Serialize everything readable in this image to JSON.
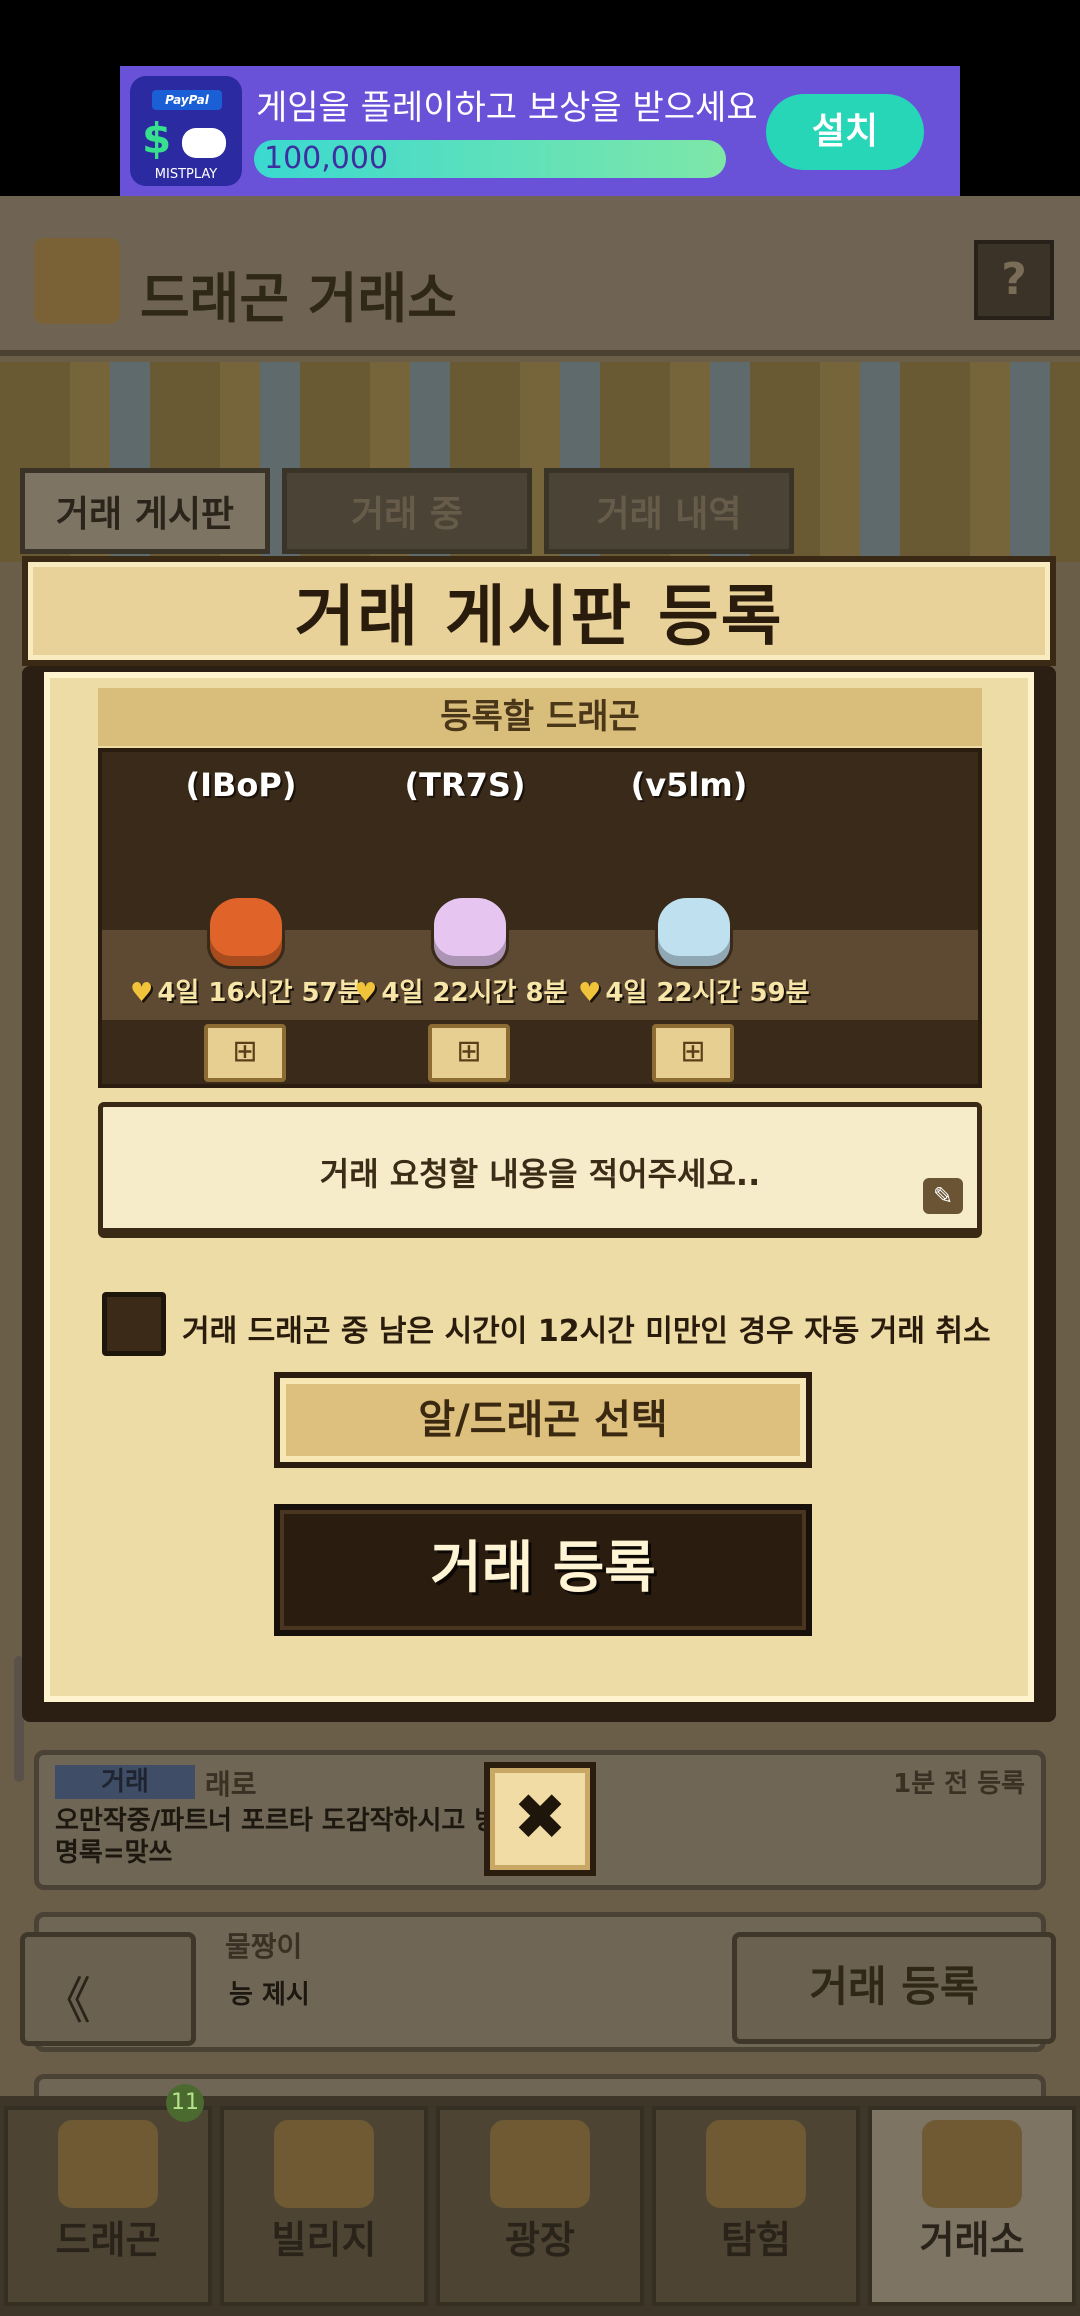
{
  "ad": {
    "logo_paypal": "PayPal",
    "logo_brand": "MISTPLAY",
    "title": "게임을 플레이하고 보상을 받으세요",
    "reward": "100,000",
    "install": "설치"
  },
  "header": {
    "title": "드래곤 거래소",
    "help": "?"
  },
  "tabs": [
    {
      "label": "거래 게시판"
    },
    {
      "label": "거래 중"
    },
    {
      "label": "거래 내역"
    }
  ],
  "listings": [
    {
      "badge": "거래",
      "name": "래로",
      "time": "1분 전 등록",
      "message": "오만작중/파트너 포르타 도감작하시고 방명록=맞쓰"
    },
    {
      "badge": "",
      "name": "물짱이",
      "time": "",
      "message": "능 제시"
    }
  ],
  "bottom": {
    "prev": "《",
    "register": "거래 등록"
  },
  "nav": [
    {
      "label": "드래곤"
    },
    {
      "label": "빌리지"
    },
    {
      "label": "광장"
    },
    {
      "label": "탐험"
    },
    {
      "label": "거래소"
    }
  ],
  "nav_badge": "11",
  "modal": {
    "title": "거래 게시판 등록",
    "section_label": "등록할 드래곤",
    "dragons": [
      {
        "name": "(IBoP)",
        "timer": "4일 16시간 57분",
        "color": "#e0642a"
      },
      {
        "name": "(TR7S)",
        "timer": "4일 22시간 8분",
        "color": "#e6c6f0"
      },
      {
        "name": "(v5lm)",
        "timer": "4일 22시간 59분",
        "color": "#bfe0ef"
      }
    ],
    "request_placeholder": "거래 요청할 내용을 적어주세요..",
    "auto_cancel_label": "거래 드래곤 중 남은 시간이 12시간 미만인 경우 자동 거래 취소",
    "auto_cancel_checked": false,
    "select_button": "알/드래곤 선택",
    "register_button": "거래 등록",
    "close": "✖"
  },
  "colors": {
    "accent": "#2a1c0e",
    "paper": "#eedca6",
    "ad_bg": "#6a52d8",
    "install": "#26d6b6"
  }
}
